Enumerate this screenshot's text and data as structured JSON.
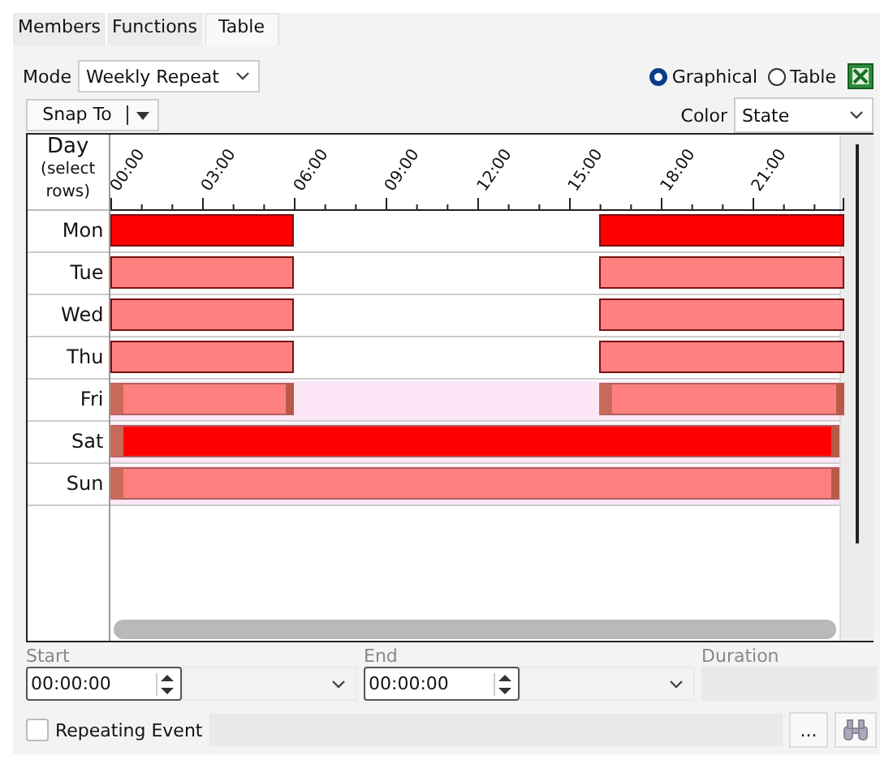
{
  "tabs": [
    {
      "label": "Members",
      "selected": false
    },
    {
      "label": "Functions",
      "selected": false
    },
    {
      "label": "Table",
      "selected": true
    }
  ],
  "mode": {
    "label": "Mode",
    "value": "Weekly Repeat"
  },
  "view": [
    {
      "label": "Graphical",
      "selected": true
    },
    {
      "label": "Table",
      "selected": false
    }
  ],
  "snap_button": "Snap To",
  "color_select": {
    "label": "Color",
    "value": "State"
  },
  "grid": {
    "day_header": "Day",
    "day_subheader": "(select rows)",
    "ticks": [
      "00:00",
      "03:00",
      "06:00",
      "09:00",
      "12:00",
      "15:00",
      "18:00",
      "21:00"
    ],
    "rows": [
      {
        "day": "Mon",
        "selected": false,
        "segments": [
          {
            "kind": "block",
            "level": 0.25,
            "color": "#ff0000"
          },
          {
            "kind": "gap",
            "level": 0.4167
          },
          {
            "kind": "block",
            "level": 0.3333,
            "color": "#ff0000"
          }
        ]
      },
      {
        "day": "Tue",
        "selected": false,
        "segments": [
          {
            "kind": "block",
            "level": 0.25,
            "color": "#ff8080"
          },
          {
            "kind": "gap",
            "level": 0.4167
          },
          {
            "kind": "block",
            "level": 0.3333,
            "color": "#ff8080"
          }
        ]
      },
      {
        "day": "Wed",
        "selected": false,
        "segments": [
          {
            "kind": "block",
            "level": 0.25,
            "color": "#ff8080"
          },
          {
            "kind": "gap",
            "level": 0.4167
          },
          {
            "kind": "block",
            "level": 0.3333,
            "color": "#ff8080"
          }
        ]
      },
      {
        "day": "Thu",
        "selected": false,
        "segments": [
          {
            "kind": "block",
            "level": 0.25,
            "color": "#ff8080"
          },
          {
            "kind": "gap",
            "level": 0.4167
          },
          {
            "kind": "block",
            "level": 0.3333,
            "color": "#ff8080"
          }
        ]
      },
      {
        "day": "Fri",
        "selected": true,
        "segments": [
          {
            "kind": "block",
            "level": 0.25,
            "color": "#ff8080"
          },
          {
            "kind": "gap",
            "level": 0.4167
          },
          {
            "kind": "block",
            "level": 0.3333,
            "color": "#ff8080"
          }
        ]
      },
      {
        "day": "Sat",
        "selected": true,
        "segments": [
          {
            "kind": "full_day",
            "color": "#ff0000"
          }
        ]
      },
      {
        "day": "Sun",
        "selected": true,
        "segments": [
          {
            "kind": "full_day",
            "color": "#ff8080"
          }
        ]
      }
    ]
  },
  "start": {
    "label": "Start",
    "value": "00:00:00"
  },
  "end": {
    "label": "End",
    "value": "00:00:00"
  },
  "duration": {
    "label": "Duration"
  },
  "repeating_event": {
    "label": "Repeating Event",
    "checked": false
  },
  "more_button": "..."
}
